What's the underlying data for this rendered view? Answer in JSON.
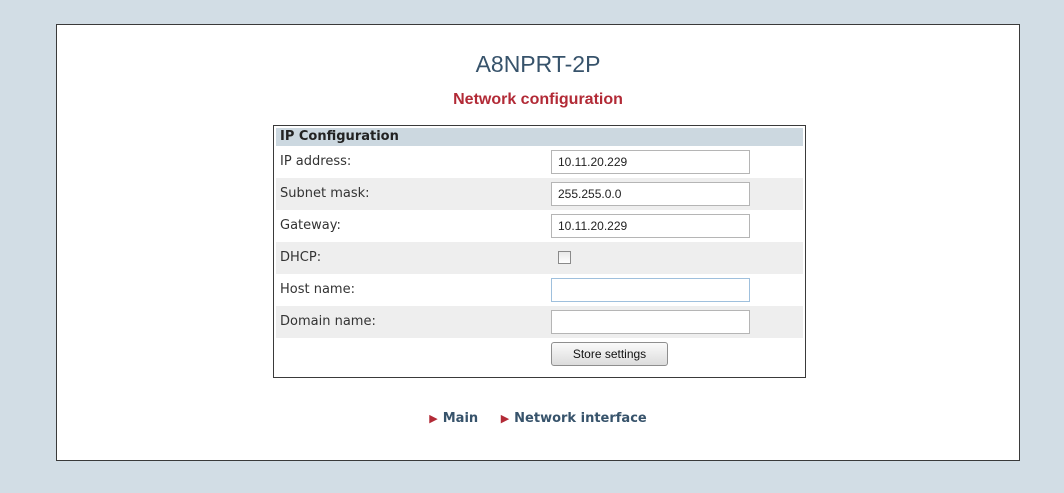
{
  "header": {
    "device_name": "A8NPRT-2P",
    "page_title": "Network configuration"
  },
  "ip_config": {
    "section_title": "IP Configuration",
    "fields": {
      "ip_address": {
        "label": "IP address:",
        "value": "10.11.20.229"
      },
      "subnet_mask": {
        "label": "Subnet mask:",
        "value": "255.255.0.0"
      },
      "gateway": {
        "label": "Gateway:",
        "value": "10.11.20.229"
      },
      "dhcp": {
        "label": "DHCP:",
        "checked": false
      },
      "host_name": {
        "label": "Host name:",
        "value": ""
      },
      "domain_name": {
        "label": "Domain name:",
        "value": ""
      }
    },
    "store_label": "Store settings"
  },
  "nav": {
    "main": "Main",
    "network_interface": "Network interface",
    "arrow_glyph": "▶"
  },
  "colors": {
    "page_background": "#d2dde5",
    "title": "#37536b",
    "subtitle": "#b22a36",
    "section_header": "#ccd8e0",
    "alt_row": "#eeeeee"
  }
}
